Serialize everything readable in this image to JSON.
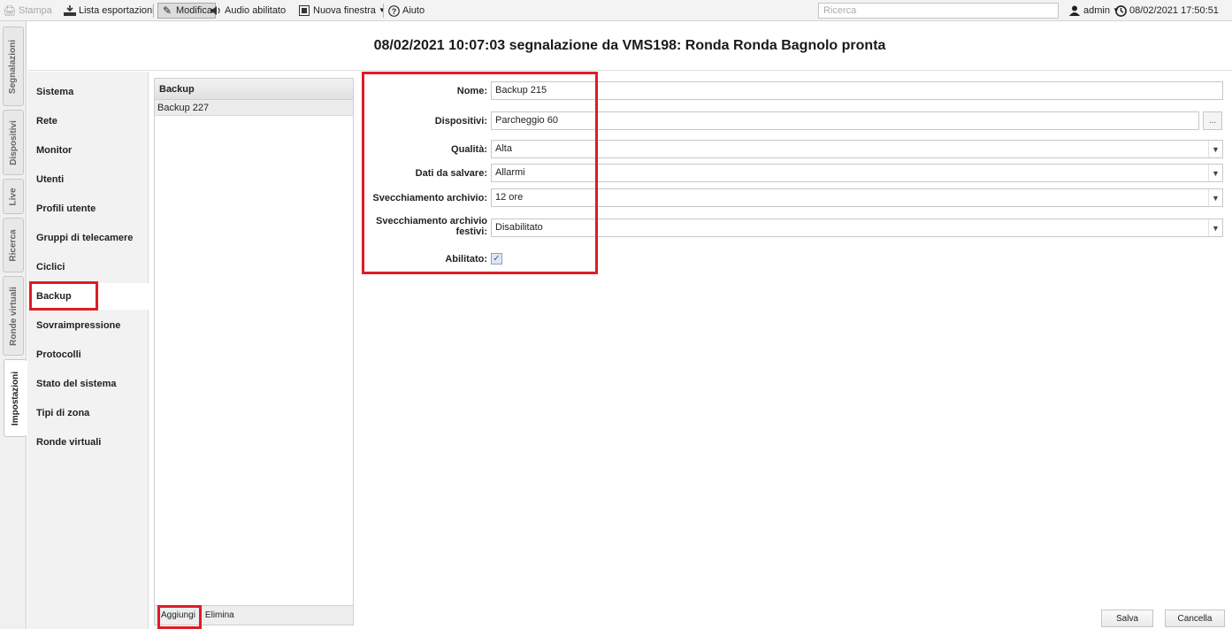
{
  "toolbar": {
    "print_label": "Stampa",
    "exports_label": "Lista esportazioni",
    "edit_label": "Modifica",
    "audio_label": "Audio abilitato",
    "new_window_label": "Nuova finestra",
    "help_label": "Aiuto",
    "search_placeholder": "Ricerca",
    "user_label": "admin",
    "datetime": "08/02/2021 17:50:51"
  },
  "vertical_tabs": [
    "Segnalazioni",
    "Dispositivi",
    "Live",
    "Ricerca",
    "Ronde virtuali",
    "Impostazioni"
  ],
  "header": {
    "title": "08/02/2021 10:07:03 segnalazione da VMS198: Ronda Ronda Bagnolo pronta"
  },
  "nav": {
    "items": [
      "Sistema",
      "Rete",
      "Monitor",
      "Utenti",
      "Profili utente",
      "Gruppi di telecamere",
      "Ciclici",
      "Backup",
      "Sovraimpressione",
      "Protocolli",
      "Stato del sistema",
      "Tipi di zona",
      "Ronde virtuali"
    ],
    "selected": "Backup"
  },
  "list": {
    "header": "Backup",
    "rows": [
      "Backup 227"
    ],
    "add_label": "Aggiungi",
    "delete_label": "Elimina"
  },
  "form": {
    "name_label": "Nome:",
    "name_value": "Backup 215",
    "devices_label": "Dispositivi:",
    "devices_value": "Parcheggio 60",
    "devices_button": "...",
    "quality_label": "Qualità:",
    "quality_value": "Alta",
    "data_label": "Dati da salvare:",
    "data_value": "Allarmi",
    "archive_label": "Svecchiamento archivio:",
    "archive_value": "12 ore",
    "archive_holidays_label_1": "Svecchiamento archivio",
    "archive_holidays_label_2": "festivi:",
    "archive_holidays_value": "Disabilitato",
    "enabled_label": "Abilitato:",
    "enabled_checked": true
  },
  "buttons": {
    "save_label": "Salva",
    "cancel_label": "Cancella"
  },
  "colors": {
    "highlight": "#e01b24"
  }
}
